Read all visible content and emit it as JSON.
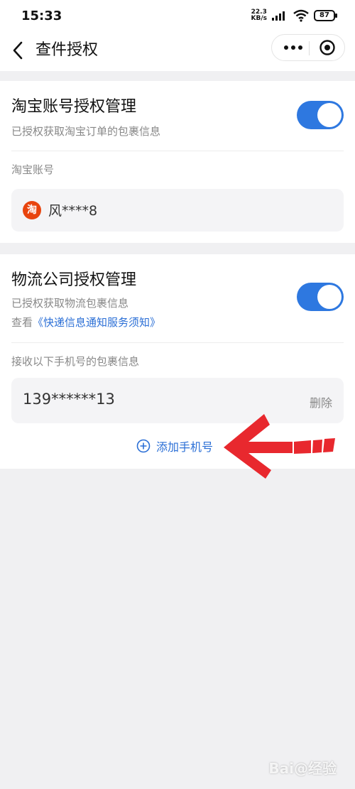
{
  "status_bar": {
    "time": "15:33",
    "net_speed_value": "22.3",
    "net_speed_unit": "KB/s",
    "battery": "87"
  },
  "nav": {
    "title": "查件授权"
  },
  "taobao": {
    "title": "淘宝账号授权管理",
    "desc": "已授权获取淘宝订单的包裹信息",
    "toggle_on": true,
    "account_label": "淘宝账号",
    "badge_char": "淘",
    "account_value": "风****8"
  },
  "logistics": {
    "title": "物流公司授权管理",
    "desc": "已授权获取物流包裹信息",
    "view_prefix": "查看",
    "notice_link": "《快递信息通知服务须知》",
    "toggle_on": true,
    "receive_label": "接收以下手机号的包裹信息",
    "phone": "139******13",
    "delete_label": "删除",
    "add_phone_label": "添加手机号"
  },
  "watermark": "Bai@经验",
  "colors": {
    "accent": "#2e78e0",
    "link": "#2b6fd6",
    "taobao_orange": "#e8440e",
    "arrow_red": "#e8282e"
  }
}
